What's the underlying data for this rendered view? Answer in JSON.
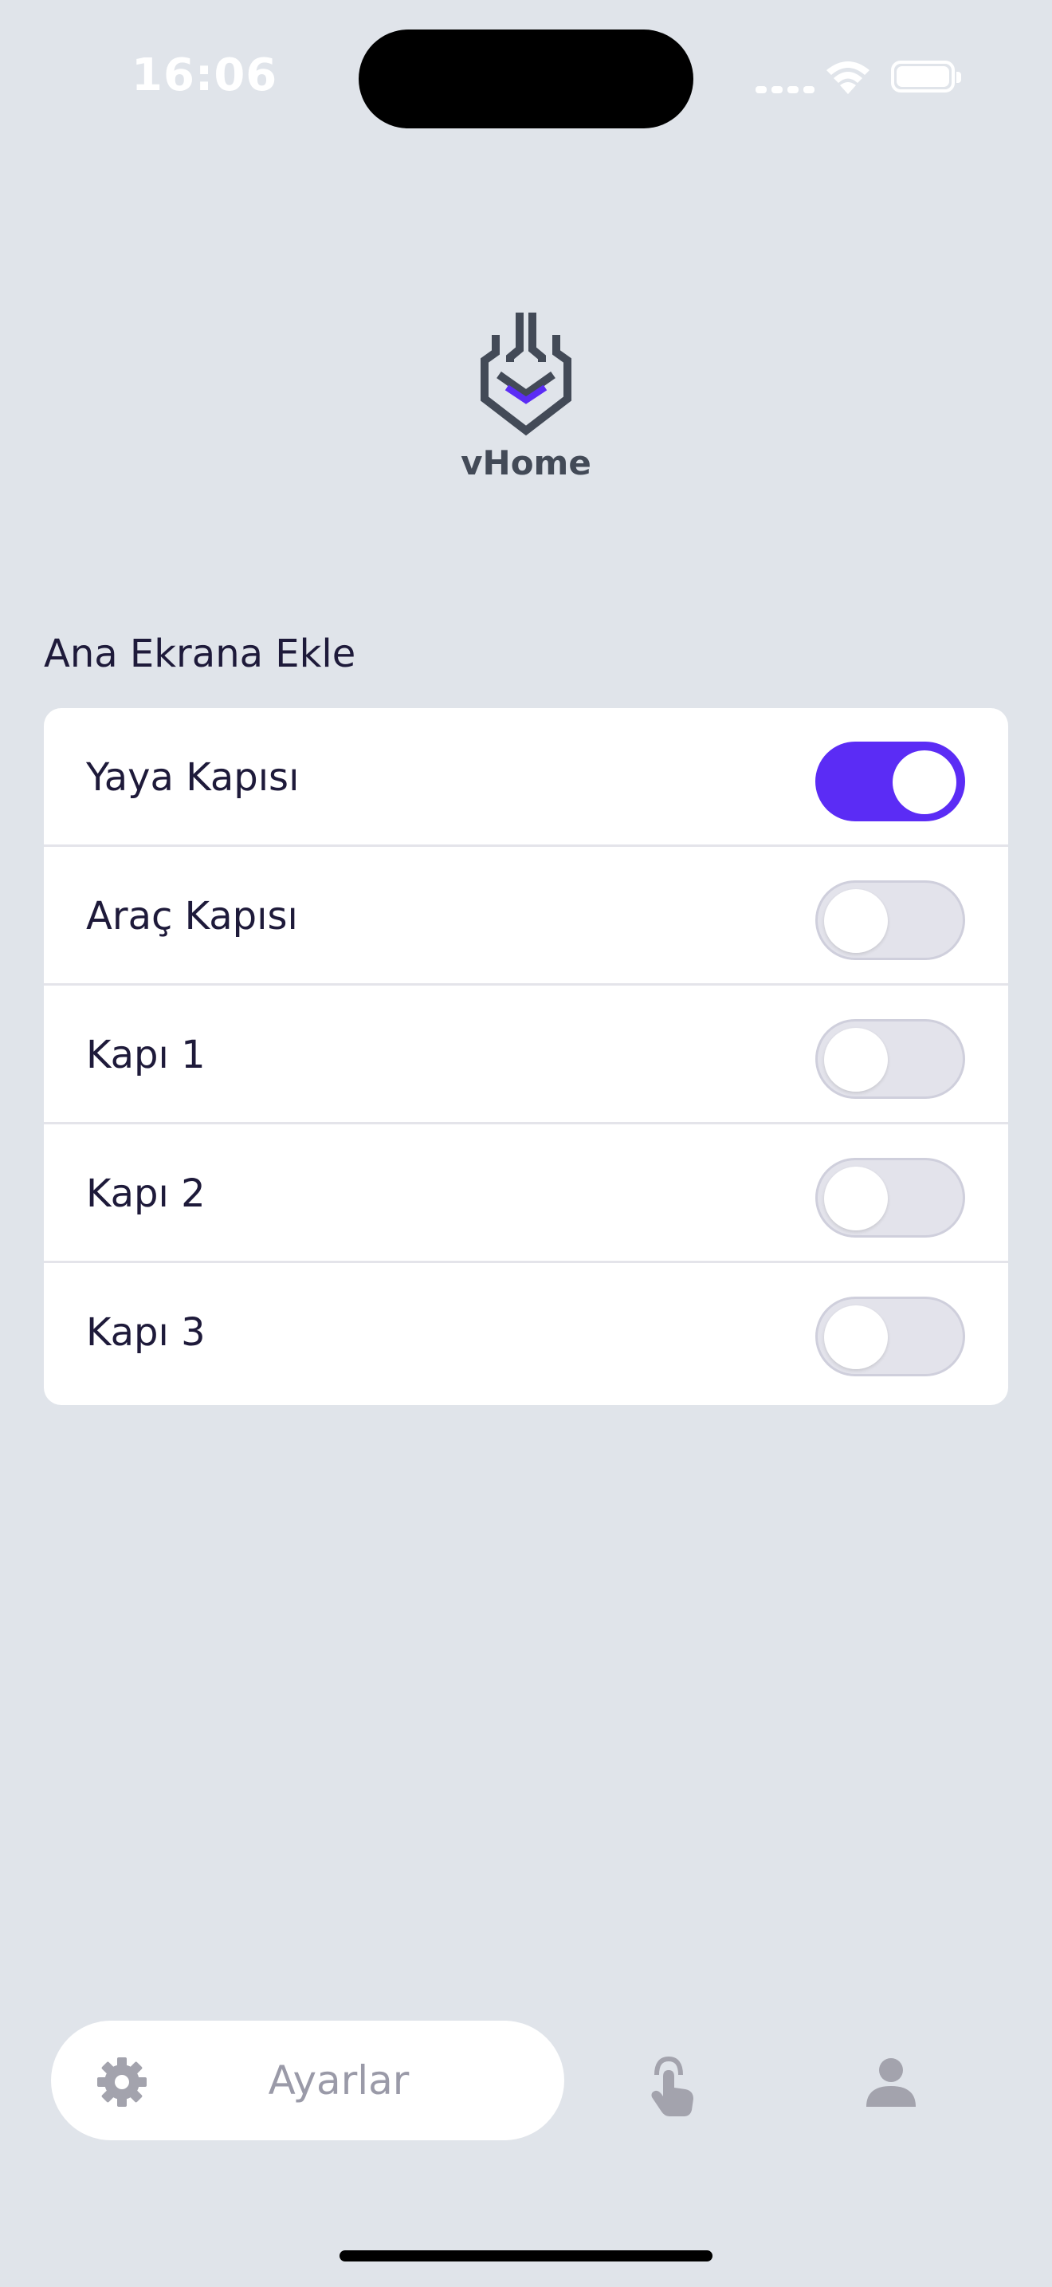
{
  "status_bar": {
    "time": "16:06"
  },
  "logo": {
    "text": "vHome",
    "icon": "vhome-shield-logo"
  },
  "section": {
    "title": "Ana Ekrana Ekle"
  },
  "toggles": [
    {
      "label": "Yaya Kapısı",
      "on": true
    },
    {
      "label": "Araç Kapısı",
      "on": false
    },
    {
      "label": "Kapı 1",
      "on": false
    },
    {
      "label": "Kapı 2",
      "on": false
    },
    {
      "label": "Kapı 3",
      "on": false
    }
  ],
  "tabbar": {
    "settings_label": "Ayarlar",
    "icons": [
      "gear-icon",
      "touch-hand-icon",
      "person-icon"
    ]
  },
  "colors": {
    "background": "#e0e4ea",
    "accent": "#5b2cf5",
    "text": "#1e1a3a",
    "tab_inactive": "#9a9aa8"
  }
}
